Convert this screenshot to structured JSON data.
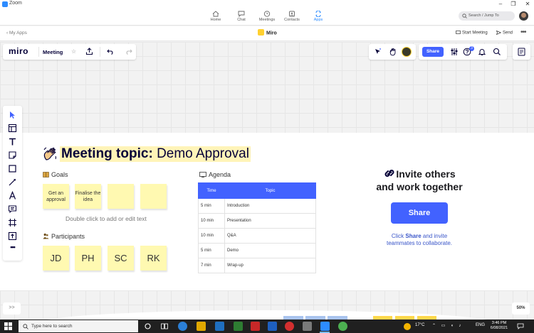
{
  "window": {
    "title": "Zoom"
  },
  "zoom_nav": {
    "tabs": [
      {
        "label": "Home",
        "icon": "home-icon"
      },
      {
        "label": "Chat",
        "icon": "chat-icon"
      },
      {
        "label": "Meetings",
        "icon": "clock-icon"
      },
      {
        "label": "Contacts",
        "icon": "contacts-icon"
      },
      {
        "label": "Apps",
        "icon": "apps-icon",
        "active": true
      }
    ],
    "search_placeholder": "Search / Jump To"
  },
  "apps_bar": {
    "back_label": "My Apps",
    "app_name": "Miro",
    "start_meeting": "Start Meeting",
    "send": "Send"
  },
  "miro": {
    "logo": "miro",
    "board_name": "Meeting",
    "share_label": "Share",
    "notification_count": "3",
    "zoom_level": "50%",
    "expand_label": ">>"
  },
  "frame": {
    "topic_label": "Meeting topic:",
    "topic_value": "Demo Approval",
    "goals": {
      "heading": "Goals",
      "stickies": [
        "Get an approval",
        "Finalise the idea",
        "",
        ""
      ],
      "hint": "Double click to add or edit text"
    },
    "participants": {
      "heading": "Participants",
      "stickies": [
        "JD",
        "PH",
        "SC",
        "RK"
      ]
    },
    "agenda": {
      "heading": "Agenda",
      "columns": [
        "Time",
        "Topic"
      ],
      "rows": [
        [
          "5 min",
          "Introduction"
        ],
        [
          "10 min",
          "Presentation"
        ],
        [
          "10 min",
          "Q&A"
        ],
        [
          "5 min",
          "Demo"
        ],
        [
          "7 min",
          "Wrap-up"
        ]
      ]
    },
    "invite": {
      "title_line1": "Invite others",
      "title_line2": "and work together",
      "button": "Share",
      "sub_pre": "Click",
      "sub_bold": "Share",
      "sub_post": "and invite teammates to collaborate."
    }
  },
  "taskbar": {
    "search_placeholder": "Type here to search",
    "temperature": "17°C",
    "language": "ENG",
    "time": "3:46 PM",
    "date": "6/08/2021"
  },
  "colors": {
    "miro_blue": "#4262ff",
    "sticky_yellow": "#fff9b1",
    "zoom_blue": "#2d8cff",
    "highlight": "#fff4b8"
  }
}
